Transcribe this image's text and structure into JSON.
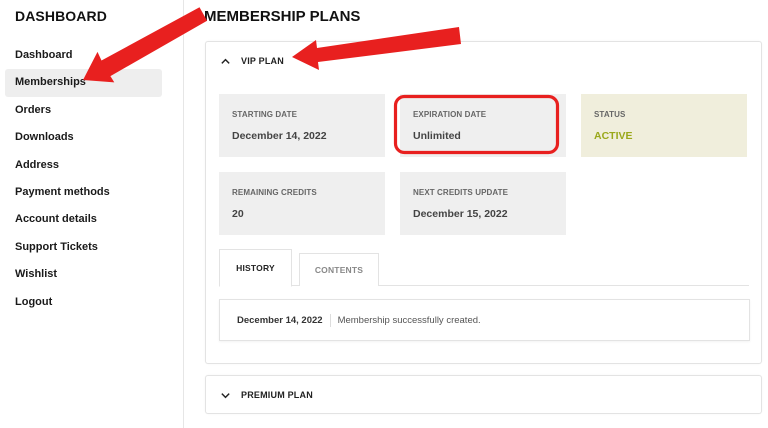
{
  "sidebar": {
    "title": "DASHBOARD",
    "items": [
      {
        "label": "Dashboard"
      },
      {
        "label": "Memberships"
      },
      {
        "label": "Orders"
      },
      {
        "label": "Downloads"
      },
      {
        "label": "Address"
      },
      {
        "label": "Payment methods"
      },
      {
        "label": "Account details"
      },
      {
        "label": "Support Tickets"
      },
      {
        "label": "Wishlist"
      },
      {
        "label": "Logout"
      }
    ],
    "active_item": "Memberships"
  },
  "main": {
    "title": "MEMBERSHIP PLANS",
    "plans": [
      {
        "name": "VIP PLAN",
        "expanded": true,
        "cards": [
          {
            "label": "STARTING DATE",
            "value": "December 14, 2022"
          },
          {
            "label": "EXPIRATION DATE",
            "value": "Unlimited"
          },
          {
            "label": "STATUS",
            "value": "ACTIVE"
          },
          {
            "label": "REMAINING CREDITS",
            "value": "20"
          },
          {
            "label": "NEXT CREDITS UPDATE",
            "value": "December 15, 2022"
          }
        ],
        "tabs": [
          {
            "label": "HISTORY",
            "active": true
          },
          {
            "label": "CONTENTS",
            "active": false
          }
        ],
        "history": [
          {
            "date": "December 14, 2022",
            "message": "Membership successfully created."
          }
        ]
      },
      {
        "name": "PREMIUM PLAN",
        "expanded": false
      }
    ]
  },
  "colors": {
    "annotation_red": "#e8201f",
    "status_active": "#9aa81a",
    "card_bg": "#efefef",
    "status_card_bg": "#f0eedc"
  },
  "icons": {
    "expanded": "chevron-up-icon",
    "collapsed": "chevron-down-icon"
  }
}
